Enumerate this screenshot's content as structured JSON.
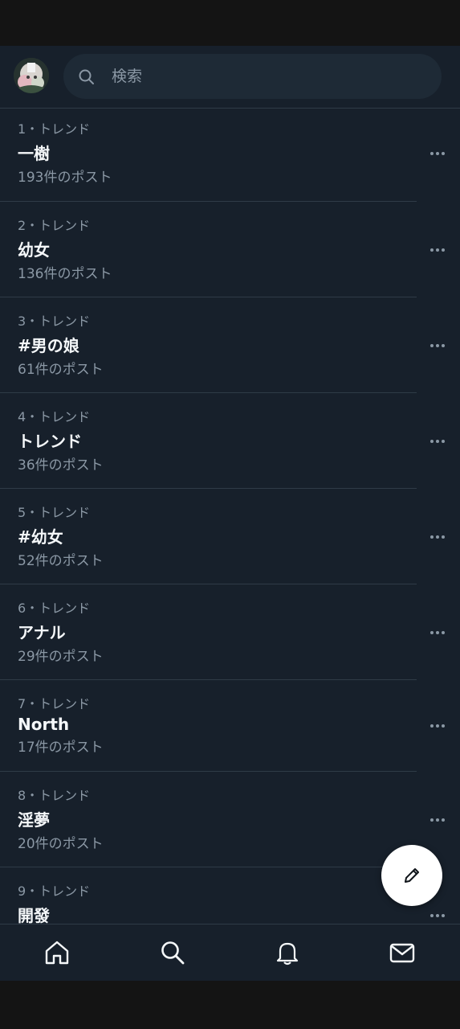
{
  "search": {
    "placeholder": "検索"
  },
  "trends": [
    {
      "meta": "1・トレンド",
      "name": "一樹",
      "count": "193件のポスト"
    },
    {
      "meta": "2・トレンド",
      "name": "幼女",
      "count": "136件のポスト"
    },
    {
      "meta": "3・トレンド",
      "name": "#男の娘",
      "count": "61件のポスト"
    },
    {
      "meta": "4・トレンド",
      "name": "トレンド",
      "count": "36件のポスト"
    },
    {
      "meta": "5・トレンド",
      "name": "#幼女",
      "count": "52件のポスト"
    },
    {
      "meta": "6・トレンド",
      "name": "アナル",
      "count": "29件のポスト"
    },
    {
      "meta": "7・トレンド",
      "name": "North",
      "count": "17件のポスト"
    },
    {
      "meta": "8・トレンド",
      "name": "淫夢",
      "count": "20件のポスト"
    },
    {
      "meta": "9・トレンド",
      "name": "開發",
      "count": ""
    }
  ],
  "icons": {
    "search": "search-icon",
    "more": "more-horizontal-icon",
    "compose": "pencil-icon",
    "home": "home-icon",
    "explore": "search-icon",
    "notifications": "bell-icon",
    "messages": "envelope-icon"
  },
  "colors": {
    "background": "#17202b",
    "text_primary": "#f5f8fa",
    "text_secondary": "#8b98a5",
    "separator": "#2f3b47"
  }
}
